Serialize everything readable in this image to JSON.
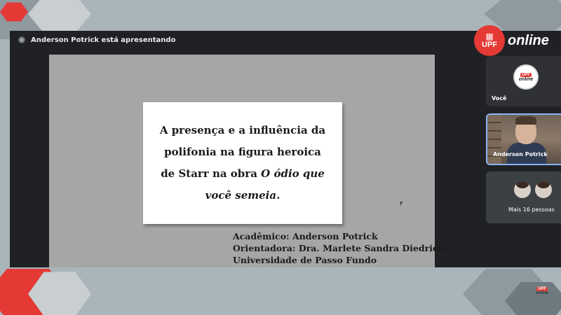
{
  "presenter": {
    "text": "Anderson Potrick está apresentando"
  },
  "brand": {
    "badge": "UPF",
    "online": "online",
    "accent": "#e53935"
  },
  "slide": {
    "title_line1": "A presença e a influência da",
    "title_line2": "polifonia na figura heroica",
    "title_line3_plain": "de Starr na obra",
    "title_line3_italic": "O ódio que",
    "title_line4_italic": "você semeia",
    "title_line4_end": ".",
    "credit_1": "Acadêmico: Anderson Potrick",
    "credit_2": "Orientadora: Dra. Marlete Sandra Diedrich",
    "credit_3": "Universidade de Passo Fundo"
  },
  "participants": {
    "you_label": "Você",
    "anderson_label": "Anderson Potrick",
    "more_label": "Mais 16 pessoas",
    "mini_logo_badge": "UPF",
    "mini_logo_online": "online"
  },
  "corner": {
    "badge": "UPF",
    "online": "online"
  }
}
